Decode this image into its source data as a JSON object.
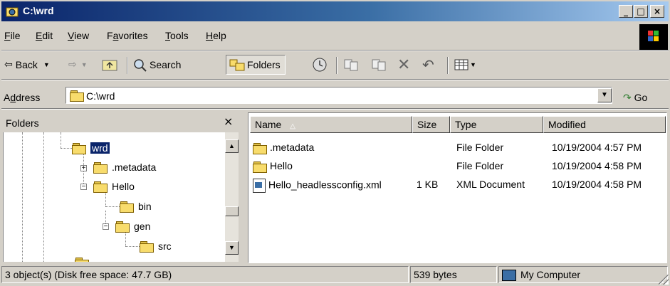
{
  "window": {
    "title": "C:\\wrd",
    "buttons": [
      "_",
      "□",
      "×"
    ]
  },
  "menu": [
    {
      "pre": "",
      "u": "F",
      "post": "ile"
    },
    {
      "pre": "",
      "u": "E",
      "post": "dit"
    },
    {
      "pre": "",
      "u": "V",
      "post": "iew"
    },
    {
      "pre": "F",
      "u": "a",
      "post": "vorites"
    },
    {
      "pre": "",
      "u": "T",
      "post": "ools"
    },
    {
      "pre": "",
      "u": "H",
      "post": "elp"
    }
  ],
  "toolbar": {
    "back": "Back",
    "search": "Search",
    "folders": "Folders"
  },
  "address": {
    "label_pre": "A",
    "label_u": "d",
    "label_post": "dress",
    "value": "C:\\wrd",
    "go": "Go"
  },
  "folders_pane": {
    "title": "Folders",
    "close": "×"
  },
  "tree": [
    {
      "label": "wrd"
    },
    {
      "label": ".metadata"
    },
    {
      "label": "Hello"
    },
    {
      "label": "bin"
    },
    {
      "label": "gen"
    },
    {
      "label": "src"
    }
  ],
  "list": {
    "columns": [
      "Name",
      "Size",
      "Type",
      "Modified"
    ],
    "rows": [
      {
        "name": ".metadata",
        "size": "",
        "type": "File Folder",
        "modified": "10/19/2004 4:57 PM"
      },
      {
        "name": "Hello",
        "size": "",
        "type": "File Folder",
        "modified": "10/19/2004 4:58 PM"
      },
      {
        "name": "Hello_headlessconfig.xml",
        "size": "1 KB",
        "type": "XML Document",
        "modified": "10/19/2004 4:58 PM"
      }
    ]
  },
  "status": {
    "objects": "3 object(s) (Disk free space: 47.7 GB)",
    "bytes": "539 bytes",
    "zone": "My Computer"
  }
}
